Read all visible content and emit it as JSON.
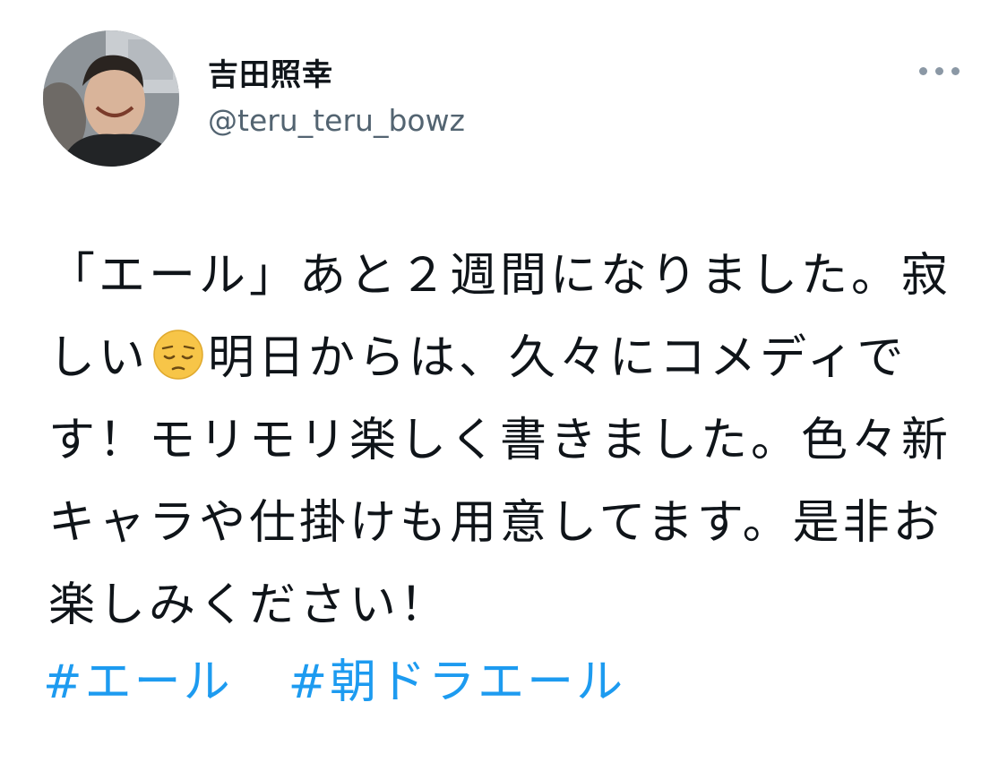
{
  "author": {
    "display_name": "吉田照幸",
    "handle": "@teru_teru_bowz",
    "avatar_icon": "profile-photo-icon"
  },
  "menu": {
    "icon": "more-horizontal-icon"
  },
  "tweet": {
    "text_before_emoji": "「エール」あと２週間になりました。寂しい",
    "emoji": "pensive-face-emoji",
    "text_after_emoji": "明日からは、久々にコメディです！モリモリ楽しく書きました。色々新キャラや仕掛けも用意してます。是非お楽しみください！",
    "hashtags": [
      "#エール",
      "#朝ドラエール"
    ]
  },
  "colors": {
    "text": "#0f1419",
    "secondary": "#536471",
    "link": "#1d9bf0",
    "emoji_face": "#f7c548"
  }
}
